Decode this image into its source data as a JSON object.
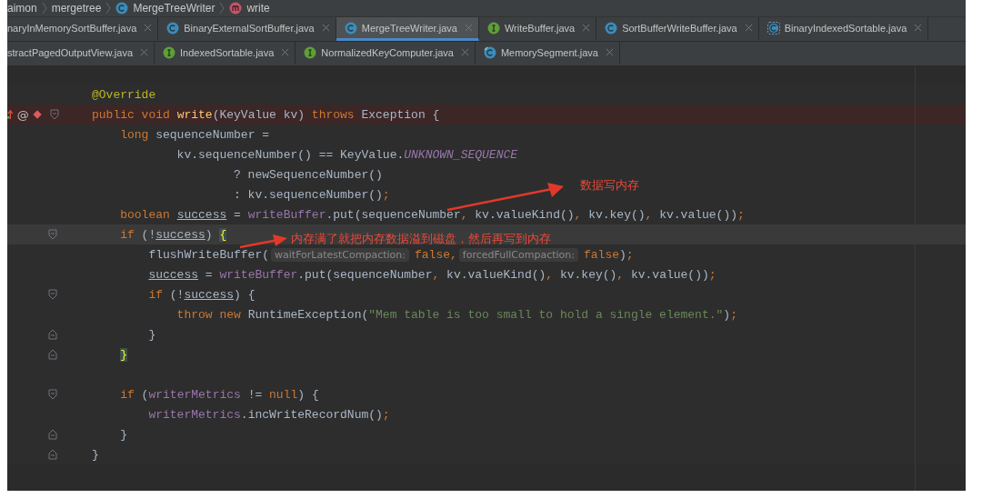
{
  "breadcrumb": [
    {
      "text": "aimon",
      "kind": "package"
    },
    {
      "text": "mergetree",
      "kind": "package"
    },
    {
      "text": "MergeTreeWriter",
      "kind": "class"
    },
    {
      "text": "write",
      "kind": "method"
    }
  ],
  "tab_rows": [
    [
      {
        "label": "naryInMemorySortBuffer.java",
        "kind": "plain",
        "selected": false
      },
      {
        "label": "BinaryExternalSortBuffer.java",
        "kind": "class",
        "selected": false
      },
      {
        "label": "MergeTreeWriter.java",
        "kind": "class",
        "selected": true
      },
      {
        "label": "WriteBuffer.java",
        "kind": "interface",
        "selected": false
      },
      {
        "label": "SortBufferWriteBuffer.java",
        "kind": "class",
        "selected": false
      },
      {
        "label": "BinaryIndexedSortable.java",
        "kind": "abstract",
        "selected": false
      }
    ],
    [
      {
        "label": "stractPagedOutputView.java",
        "kind": "plain",
        "selected": false
      },
      {
        "label": "IndexedSortable.java",
        "kind": "interface",
        "selected": false
      },
      {
        "label": "NormalizedKeyComputer.java",
        "kind": "interface",
        "selected": false
      },
      {
        "label": "MemorySegment.java",
        "kind": "linked",
        "selected": false
      }
    ]
  ],
  "code_lines": [
    {
      "kind": "plain",
      "breakpoint": false,
      "current": false,
      "segments": [
        {
          "kind": "code",
          "tokens": [
            {
              "t": "@Override",
              "kind": "annotation"
            }
          ]
        }
      ]
    },
    {
      "kind": "fold_start",
      "breakpoint": true,
      "current": false,
      "gutter_mark": "@",
      "segments": [
        {
          "kind": "code",
          "tokens": [
            {
              "t": "public void ",
              "kind": "keyword"
            },
            {
              "t": "write",
              "kind": "method"
            },
            {
              "t": "(KeyValue kv) ",
              "kind": "plain"
            },
            {
              "t": "throws ",
              "kind": "keyword"
            },
            {
              "t": "Exception {",
              "kind": "plain"
            }
          ]
        }
      ]
    },
    {
      "kind": "plain",
      "breakpoint": false,
      "current": false,
      "segments": [
        {
          "kind": "code",
          "tokens": [
            {
              "t": "    long ",
              "kind": "keyword"
            },
            {
              "t": "sequenceNumber =",
              "kind": "plain"
            }
          ]
        }
      ]
    },
    {
      "kind": "plain",
      "breakpoint": false,
      "current": false,
      "segments": [
        {
          "kind": "code",
          "tokens": [
            {
              "t": "            kv.sequenceNumber() == KeyValue.",
              "kind": "plain"
            },
            {
              "t": "UNKNOWN_SEQUENCE",
              "kind": "constant"
            }
          ]
        }
      ]
    },
    {
      "kind": "plain",
      "breakpoint": false,
      "current": false,
      "segments": [
        {
          "kind": "code",
          "tokens": [
            {
              "t": "                    ? newSequenceNumber()",
              "kind": "plain"
            }
          ]
        }
      ]
    },
    {
      "kind": "plain",
      "breakpoint": false,
      "current": false,
      "segments": [
        {
          "kind": "code",
          "tokens": [
            {
              "t": "                    : kv.sequenceNumber()",
              "kind": "plain"
            },
            {
              "t": ";",
              "kind": "keyword"
            }
          ]
        }
      ]
    },
    {
      "kind": "plain",
      "breakpoint": false,
      "current": false,
      "segments": [
        {
          "kind": "code",
          "tokens": [
            {
              "t": "    boolean ",
              "kind": "keyword"
            },
            {
              "t": "success",
              "kind": "reassigned"
            },
            {
              "t": " = ",
              "kind": "plain"
            },
            {
              "t": "writeBuffer",
              "kind": "field"
            },
            {
              "t": ".put(sequenceNumber",
              "kind": "plain"
            },
            {
              "t": ", ",
              "kind": "keyword"
            },
            {
              "t": "kv.valueKind()",
              "kind": "plain"
            },
            {
              "t": ", ",
              "kind": "keyword"
            },
            {
              "t": "kv.key()",
              "kind": "plain"
            },
            {
              "t": ", ",
              "kind": "keyword"
            },
            {
              "t": "kv.value())",
              "kind": "plain"
            },
            {
              "t": ";",
              "kind": "keyword"
            }
          ]
        }
      ]
    },
    {
      "kind": "fold_start",
      "breakpoint": false,
      "current": true,
      "segments": [
        {
          "kind": "code",
          "tokens": [
            {
              "t": "    if ",
              "kind": "keyword"
            },
            {
              "t": "(!",
              "kind": "plain"
            },
            {
              "t": "success",
              "kind": "reassigned"
            },
            {
              "t": ") ",
              "kind": "plain"
            },
            {
              "t": "{",
              "kind": "brace_match"
            }
          ]
        }
      ]
    },
    {
      "kind": "plain",
      "breakpoint": false,
      "current": false,
      "segments": [
        {
          "kind": "code",
          "tokens": [
            {
              "t": "        flushWriteBuffer(",
              "kind": "plain"
            }
          ]
        },
        {
          "kind": "hint",
          "text": "waitForLatestCompaction:"
        },
        {
          "kind": "code",
          "tokens": [
            {
              "t": "false",
              "kind": "keyword"
            },
            {
              "t": ",",
              "kind": "keyword"
            }
          ]
        },
        {
          "kind": "hint",
          "text": "forcedFullCompaction:"
        },
        {
          "kind": "code",
          "tokens": [
            {
              "t": "false",
              "kind": "keyword"
            },
            {
              "t": ")",
              "kind": "plain"
            },
            {
              "t": ";",
              "kind": "keyword"
            }
          ]
        }
      ]
    },
    {
      "kind": "plain",
      "breakpoint": false,
      "current": false,
      "segments": [
        {
          "kind": "code",
          "tokens": [
            {
              "t": "        success",
              "kind": "reassigned"
            },
            {
              "t": " = ",
              "kind": "plain"
            },
            {
              "t": "writeBuffer",
              "kind": "field"
            },
            {
              "t": ".put(sequenceNumber",
              "kind": "plain"
            },
            {
              "t": ", ",
              "kind": "keyword"
            },
            {
              "t": "kv.valueKind()",
              "kind": "plain"
            },
            {
              "t": ", ",
              "kind": "keyword"
            },
            {
              "t": "kv.key()",
              "kind": "plain"
            },
            {
              "t": ", ",
              "kind": "keyword"
            },
            {
              "t": "kv.value())",
              "kind": "plain"
            },
            {
              "t": ";",
              "kind": "keyword"
            }
          ]
        }
      ]
    },
    {
      "kind": "fold_start",
      "breakpoint": false,
      "current": false,
      "segments": [
        {
          "kind": "code",
          "tokens": [
            {
              "t": "        if ",
              "kind": "keyword"
            },
            {
              "t": "(!",
              "kind": "plain"
            },
            {
              "t": "success",
              "kind": "reassigned"
            },
            {
              "t": ") {",
              "kind": "plain"
            }
          ]
        }
      ]
    },
    {
      "kind": "plain",
      "breakpoint": false,
      "current": false,
      "segments": [
        {
          "kind": "code",
          "tokens": [
            {
              "t": "            throw new ",
              "kind": "keyword"
            },
            {
              "t": "RuntimeException(",
              "kind": "plain"
            },
            {
              "t": "\"Mem table is too small to hold a single element.\"",
              "kind": "string"
            },
            {
              "t": ")",
              "kind": "plain"
            },
            {
              "t": ";",
              "kind": "keyword"
            }
          ]
        }
      ]
    },
    {
      "kind": "fold_end",
      "breakpoint": false,
      "current": false,
      "segments": [
        {
          "kind": "code",
          "tokens": [
            {
              "t": "        }",
              "kind": "plain"
            }
          ]
        }
      ]
    },
    {
      "kind": "fold_end",
      "breakpoint": false,
      "current": false,
      "segments": [
        {
          "kind": "code",
          "tokens": [
            {
              "t": "    }",
              "kind": "brace_match"
            }
          ]
        }
      ]
    },
    {
      "kind": "blank",
      "breakpoint": false,
      "current": false
    },
    {
      "kind": "fold_start",
      "breakpoint": false,
      "current": false,
      "segments": [
        {
          "kind": "code",
          "tokens": [
            {
              "t": "    if ",
              "kind": "keyword"
            },
            {
              "t": "(",
              "kind": "plain"
            },
            {
              "t": "writerMetrics",
              "kind": "field"
            },
            {
              "t": " != ",
              "kind": "plain"
            },
            {
              "t": "null",
              "kind": "keyword"
            },
            {
              "t": ") {",
              "kind": "plain"
            }
          ]
        }
      ]
    },
    {
      "kind": "plain",
      "breakpoint": false,
      "current": false,
      "segments": [
        {
          "kind": "code",
          "tokens": [
            {
              "t": "        writerMetrics",
              "kind": "field"
            },
            {
              "t": ".incWriteRecordNum()",
              "kind": "plain"
            },
            {
              "t": ";",
              "kind": "keyword"
            }
          ]
        }
      ]
    },
    {
      "kind": "fold_end",
      "breakpoint": false,
      "current": false,
      "segments": [
        {
          "kind": "code",
          "tokens": [
            {
              "t": "    }",
              "kind": "plain"
            }
          ]
        }
      ]
    },
    {
      "kind": "fold_end",
      "breakpoint": false,
      "current": false,
      "segments": [
        {
          "kind": "code",
          "tokens": [
            {
              "t": "}",
              "kind": "plain"
            }
          ]
        }
      ]
    }
  ],
  "annotations": [
    {
      "text": "数据写内存"
    },
    {
      "text": "内存满了就把内存数据溢到磁盘，然后再写到内存"
    }
  ]
}
